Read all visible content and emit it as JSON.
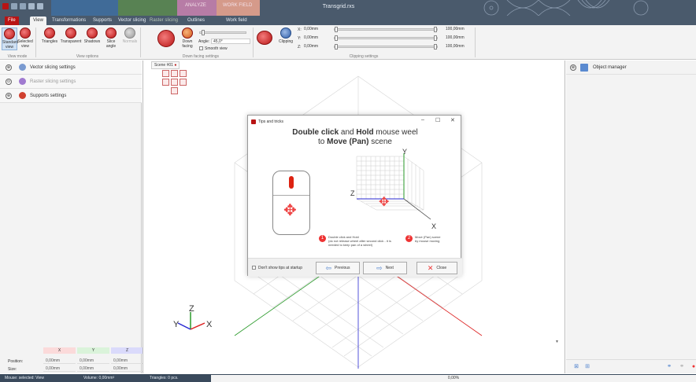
{
  "window": {
    "title": "Transgrid.rxs",
    "context_tabs": [
      "ANALYZE",
      "WORK FIELD"
    ],
    "colors": {
      "titlebar": "#4a5a6c",
      "accent_red": "#b81414",
      "analyze": "#b77ca6",
      "workfield": "#d59a8a"
    }
  },
  "tabs": [
    "File",
    "View",
    "Transformations",
    "Supports",
    "Vector slicing",
    "Raster slicing",
    "Outlines",
    "Work field"
  ],
  "ribbon": {
    "view_mode": {
      "group": "View mode",
      "buttons": [
        "Standard view",
        "Selected view"
      ]
    },
    "view_options": {
      "group": "View options",
      "buttons": [
        "Triangles",
        "Transparent",
        "Shadows",
        "Slice angle",
        "Normals"
      ]
    },
    "down_facing": {
      "group": "Down facing settings",
      "button": "Down facing",
      "angle_label": "Angle:",
      "angle_value": "45,0°",
      "smooth_label": "Smooth view"
    },
    "clipping": {
      "group": "Clipping settings",
      "button": "Clipping",
      "axes": [
        {
          "axis": "X:",
          "min": "0,00mm",
          "max": "100,00mm"
        },
        {
          "axis": "Y:",
          "min": "0,00mm",
          "max": "100,00mm"
        },
        {
          "axis": "Z:",
          "min": "0,00mm",
          "max": "100,00mm"
        }
      ]
    }
  },
  "left_panel": {
    "rows": [
      {
        "label": "Vector slicing settings",
        "expand": "⊕",
        "color": "#7a9ad0",
        "disabled": false
      },
      {
        "label": "Raster slicing settings",
        "expand": "⊙",
        "color": "#a07ad0",
        "disabled": true
      },
      {
        "label": "Supports settings",
        "expand": "⊕",
        "color": "#d0402f",
        "disabled": false
      }
    ],
    "transform": {
      "columns": [
        "X",
        "Y",
        "Z"
      ],
      "column_colors": [
        "#fbdada",
        "#daf3da",
        "#dadafb"
      ],
      "rows": [
        {
          "label": "Position:",
          "values": [
            "0,00mm",
            "0,00mm",
            "0,00mm"
          ]
        },
        {
          "label": "Size:",
          "values": [
            "0,00mm",
            "0,00mm",
            "0,00mm"
          ]
        }
      ]
    }
  },
  "viewport": {
    "tab_label": "Scene #01"
  },
  "dialog": {
    "title": "Tips and tricks",
    "controls": [
      "–",
      "☐",
      "✕"
    ],
    "heading_line1_a": "Double click",
    "heading_line1_b": " and ",
    "heading_line1_c": "Hold",
    "heading_line1_d": " mouse weel",
    "heading_line2_a": "to ",
    "heading_line2_b": "Move (Pan)",
    "heading_line2_c": " scene",
    "axis_y": "Y",
    "axis_z": "Z",
    "axis_x": "X",
    "legend": [
      {
        "num": "1",
        "title": "Double click and Hold",
        "desc": "(do not release wheel after second click - it is needed to keep pan of a wheel)"
      },
      {
        "num": "2",
        "title": "Move (Pan) scene",
        "desc": "by mouse moving"
      }
    ],
    "checkbox_label": "Don't show tips at startup",
    "buttons": {
      "previous": "Previous",
      "next": "Next",
      "close": "Close"
    }
  },
  "right_panel": {
    "title": "Object manager",
    "expand": "⊕"
  },
  "gizmo": {
    "y": "Y",
    "z": "Z",
    "x": "X"
  },
  "statusbar": {
    "items": [
      "Mouse: selected: View",
      "Volume: 0,00mm³",
      "Triangles: 0 pcs."
    ],
    "progress": "0,00%"
  }
}
